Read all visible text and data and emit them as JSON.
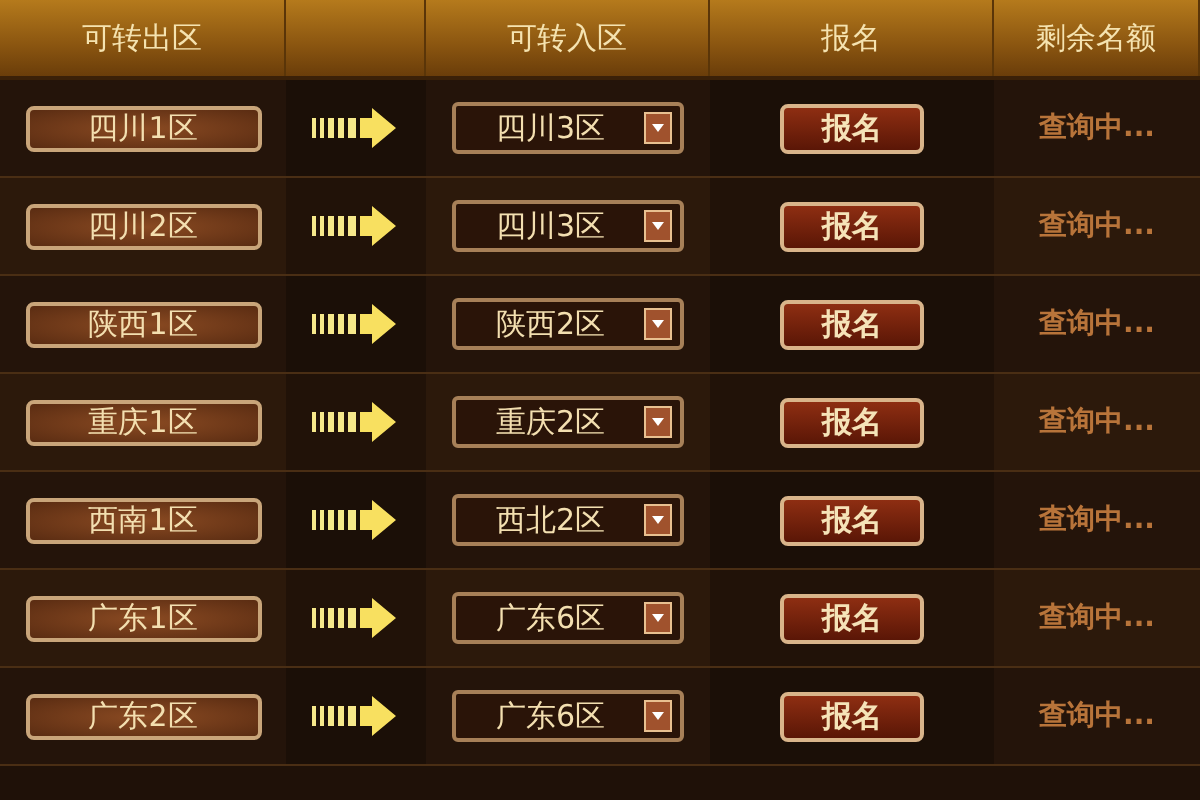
{
  "table": {
    "columns": [
      "可转出区",
      "",
      "可转入区",
      "报名",
      "剩余名额"
    ],
    "rows": [
      {
        "from": "四川1区",
        "to": "四川3区",
        "action": "报名",
        "remaining": "查询中..."
      },
      {
        "from": "四川2区",
        "to": "四川3区",
        "action": "报名",
        "remaining": "查询中..."
      },
      {
        "from": "陕西1区",
        "to": "陕西2区",
        "action": "报名",
        "remaining": "查询中..."
      },
      {
        "from": "重庆1区",
        "to": "重庆2区",
        "action": "报名",
        "remaining": "查询中..."
      },
      {
        "from": "西南1区",
        "to": "西北2区",
        "action": "报名",
        "remaining": "查询中..."
      },
      {
        "from": "广东1区",
        "to": "广东6区",
        "action": "报名",
        "remaining": "查询中..."
      },
      {
        "from": "广东2区",
        "to": "广东6区",
        "action": "报名",
        "remaining": "查询中..."
      }
    ]
  }
}
